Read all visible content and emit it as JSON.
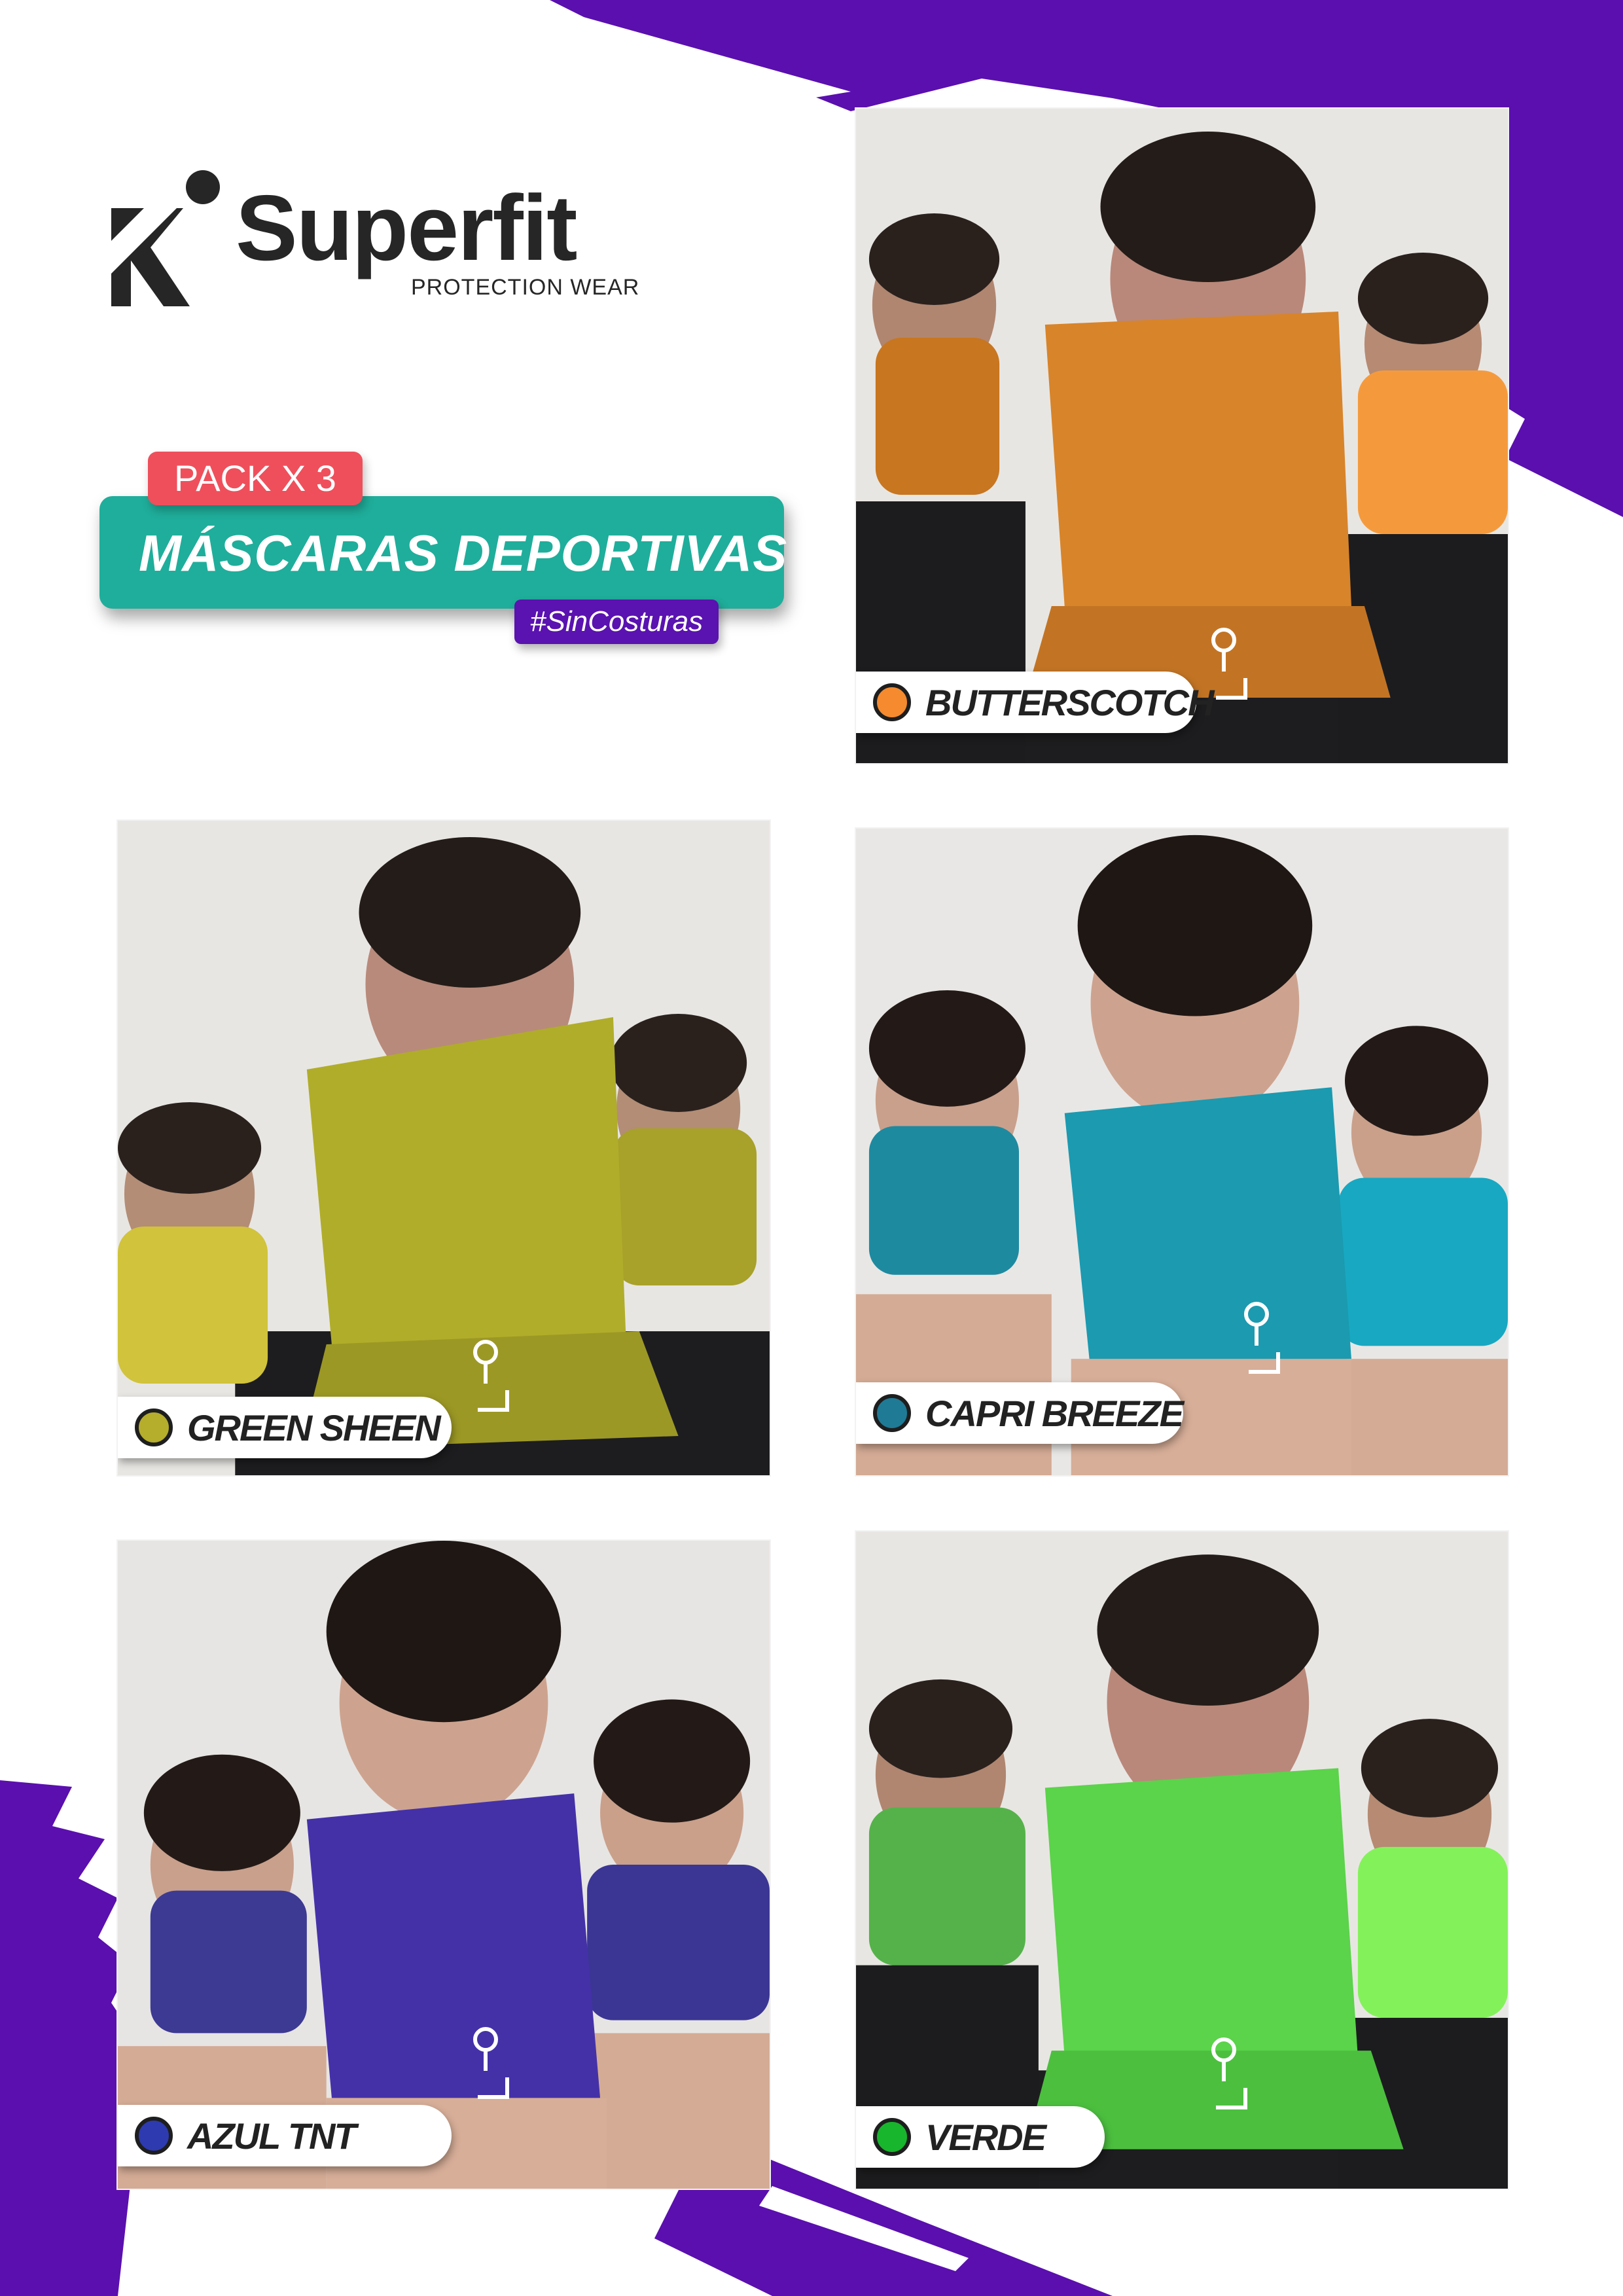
{
  "brand": {
    "name": "Superfit",
    "tagline": "PROTECTION WEAR"
  },
  "header": {
    "pack": "PACK X 3",
    "title": "MÁSCARAS  DEPORTIVAS",
    "hashtag": "#SinCosturas"
  },
  "colors": {
    "purple": "#5a0fae",
    "teal": "#1fae9b",
    "coral": "#ef4f5b"
  },
  "products": [
    {
      "name": "BUTTERSCOTCH",
      "swatch": "#f58a2e",
      "mask": "#d8842a",
      "mask_side": "#f59a3c"
    },
    {
      "name": "GREEN SHEEN",
      "swatch": "#b5ad2c",
      "mask": "#b0ad2a",
      "mask_side": "#cfc53e"
    },
    {
      "name": "CAPRI BREEZE",
      "swatch": "#1f7a95",
      "mask": "#1b9ab0",
      "mask_side": "#18a8c2"
    },
    {
      "name": "AZUL TNT",
      "swatch": "#2d3ab0",
      "mask": "#4431a8",
      "mask_side": "#3b3694"
    },
    {
      "name": "VERDE",
      "swatch": "#18b62d",
      "mask": "#5bd34a",
      "mask_side": "#83f25a"
    }
  ]
}
